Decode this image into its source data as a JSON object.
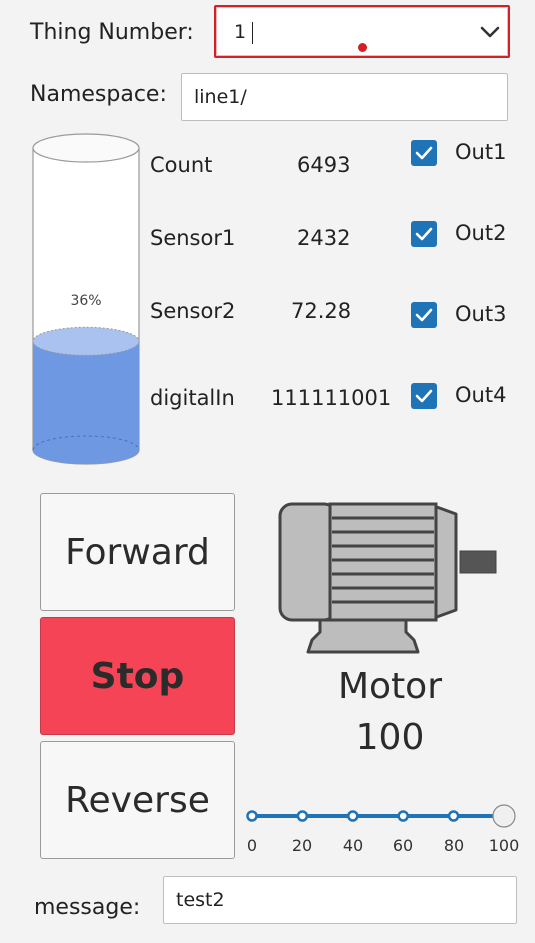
{
  "thing": {
    "label": "Thing Number:",
    "value": "1"
  },
  "namespace": {
    "label": "Namespace:",
    "value": "line1/"
  },
  "tank": {
    "level_percent": 36,
    "label": "36%"
  },
  "readings": [
    {
      "name": "Count",
      "value": "6493"
    },
    {
      "name": "Sensor1",
      "value": "2432"
    },
    {
      "name": "Sensor2",
      "value": "72.28"
    },
    {
      "name": "digitalIn",
      "value": "111111001"
    }
  ],
  "outputs": [
    {
      "label": "Out1",
      "checked": true
    },
    {
      "label": "Out2",
      "checked": true
    },
    {
      "label": "Out3",
      "checked": true
    },
    {
      "label": "Out4",
      "checked": true
    }
  ],
  "controls": {
    "forward": "Forward",
    "stop": "Stop",
    "reverse": "Reverse"
  },
  "motor": {
    "title": "Motor",
    "speed": "100"
  },
  "slider": {
    "value": 100,
    "min": 0,
    "max": 100,
    "ticks": [
      "0",
      "20",
      "40",
      "60",
      "80",
      "100"
    ]
  },
  "message": {
    "label": "message:",
    "value": "test2"
  },
  "colors": {
    "accent": "#1f74b8",
    "stop": "#f44455",
    "tank_liquid": "#6f98e3",
    "error_border": "#d31f26"
  }
}
